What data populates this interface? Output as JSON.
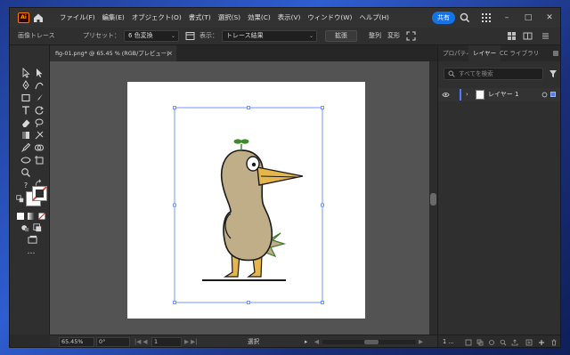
{
  "app": {
    "logo": "Ai"
  },
  "menu": {
    "items": [
      "ファイル(F)",
      "編集(E)",
      "オブジェクト(O)",
      "書式(T)",
      "選択(S)",
      "効果(C)",
      "表示(V)",
      "ウィンドウ(W)",
      "ヘルプ(H)"
    ],
    "share_label": "共有"
  },
  "control_bar": {
    "panel_name": "画像トレース",
    "preset_label": "プリセット：",
    "preset_value": "6 色変換",
    "view_label": "表示：",
    "view_value": "トレース結果",
    "expand_label": "拡張",
    "align_label": "整列",
    "transform_label": "変形"
  },
  "document_tab": {
    "title": "fig-01.png* @ 65.45 % (RGB/プレビュー)",
    "close": "×"
  },
  "status_bar": {
    "zoom": "65.45%",
    "rotation": "0°",
    "artboard_number": "1",
    "tool_name": "選択"
  },
  "panel": {
    "tabs": [
      "プロパティ",
      "レイヤー",
      "CC ライブラリ"
    ],
    "active_tab": "レイヤー",
    "search_placeholder": "すべてを検索",
    "layers": [
      {
        "name": "レイヤー 1"
      }
    ],
    "footer_count": "1 ..."
  },
  "colors": {
    "accent": "#1473e6",
    "layer_color": "#4f7cff",
    "duck_body": "#bfae88",
    "duck_beak": "#e7b64a",
    "duck_leaf": "#3e8a2a"
  },
  "icons": [
    "home-icon",
    "search-icon",
    "grid-icon",
    "expand-icon",
    "minimize-icon",
    "maximize-icon",
    "close-icon"
  ]
}
